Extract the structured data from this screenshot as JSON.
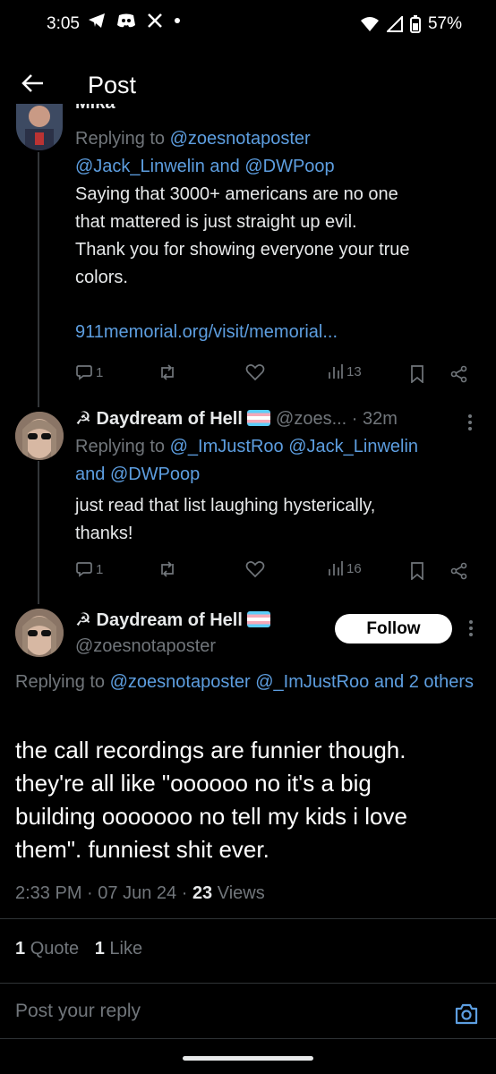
{
  "status_bar": {
    "time": "3:05",
    "battery": "57%",
    "icons_left": [
      "telegram-icon",
      "discord-icon",
      "x-icon",
      "dot-icon"
    ],
    "icons_right": [
      "wifi-icon",
      "signal-icon",
      "battery-icon"
    ]
  },
  "header": {
    "title": "Post",
    "back_icon": "arrow-left-icon"
  },
  "reply1": {
    "top_cutoff_name": "Mika",
    "replying_to": "Replying to",
    "mention1": "@zoesnotaposter",
    "mention2": "@Jack_Linwelin",
    "and_word": "and",
    "mention3": "@DWPoop",
    "text": [
      "Saying that 3000+ americans are no one",
      "that mattered is just straight up evil.",
      "Thank you for showing everyone your true",
      "colors."
    ],
    "link": "911memorial.org/visit/memorial...",
    "replies": "1",
    "views": "13"
  },
  "reply2": {
    "name": "Daydream of Hell",
    "handle": "@zoes...",
    "time": "· 32m",
    "replying_to": "Replying to",
    "mention1": "@_ImJustRoo",
    "mention2": "@Jack_Linwelin",
    "and_word": "and",
    "mention3": "@DWPoop",
    "text": [
      "just read that list laughing hysterically,",
      "thanks!"
    ],
    "replies": "1",
    "views": "16"
  },
  "main_post": {
    "name": "Daydream of Hell",
    "handle": "@zoesnotaposter",
    "follow_label": "Follow",
    "replying_to": "Replying to",
    "mention1": "@zoesnotaposter",
    "mention2": "@_ImJustRoo",
    "and_more": "and 2 others",
    "text": [
      "the call recordings are funnier though.",
      "they're all like \"oooooo no it's a big",
      "building ooooooo no tell my kids i love",
      "them\". funniest shit ever."
    ],
    "time": "2:33 PM",
    "date": "07 Jun 24",
    "views_count": "23",
    "views_label": "Views",
    "quotes_count": "1",
    "quotes_label": "Quote",
    "likes_count": "1",
    "likes_label": "Like"
  },
  "reply_box": {
    "placeholder": "Post your reply",
    "camera_icon": "camera-icon"
  },
  "colors": {
    "link": "#5d9ee0",
    "muted": "#71767b",
    "bg": "#000000",
    "text": "#e7e9ea"
  }
}
